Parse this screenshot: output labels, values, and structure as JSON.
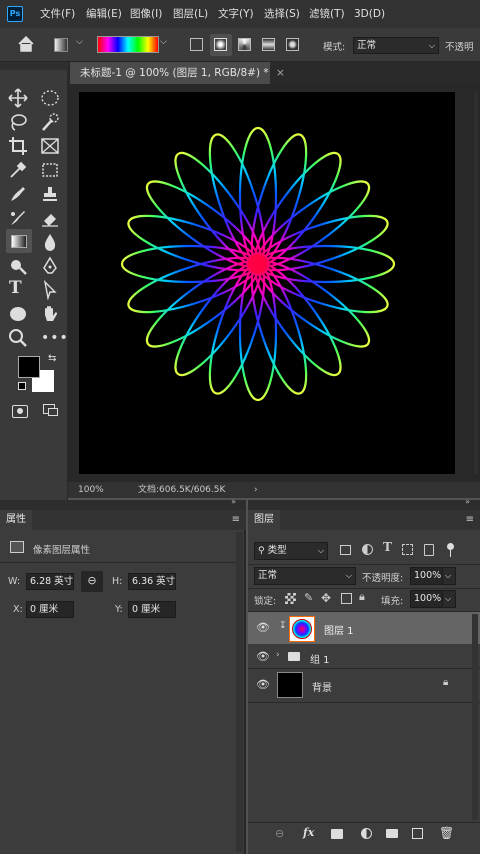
{
  "app": {
    "logo_text": "Ps"
  },
  "menu": [
    "文件(F)",
    "编辑(E)",
    "图像(I)",
    "图层(L)",
    "文字(Y)",
    "选择(S)",
    "滤镜(T)",
    "3D(D)"
  ],
  "options_bar": {
    "mode_label": "模式:",
    "mode_value": "正常",
    "opacity_label": "不透明"
  },
  "document": {
    "tab_title": "未标题-1 @ 100% (图层 1, RGB/8#) *",
    "close_glyph": "×"
  },
  "status_bar": {
    "zoom": "100%",
    "doc_size": "文档:606.5K/606.5K",
    "arrow": "›"
  },
  "properties_panel": {
    "tab": "属性",
    "section_title": "像素图层属性",
    "w_label": "W:",
    "w_value": "6.28 英寸",
    "h_label": "H:",
    "h_value": "6.36 英寸",
    "x_label": "X:",
    "x_value": "0 厘米",
    "y_label": "Y:",
    "y_value": "0 厘米"
  },
  "layers_panel": {
    "tab": "图层",
    "filter_value": "类型",
    "blend_mode": "正常",
    "opacity_label": "不透明度:",
    "opacity_value": "100%",
    "lock_label": "锁定:",
    "fill_label": "填充:",
    "fill_value": "100%",
    "layers": [
      {
        "name": "图层 1",
        "selected": true
      },
      {
        "name": "组 1",
        "selected": false
      },
      {
        "name": "背景",
        "selected": false
      }
    ]
  },
  "colors": {
    "accent": "#31a8ff",
    "foreground": "#000000",
    "background": "#ffffff"
  }
}
